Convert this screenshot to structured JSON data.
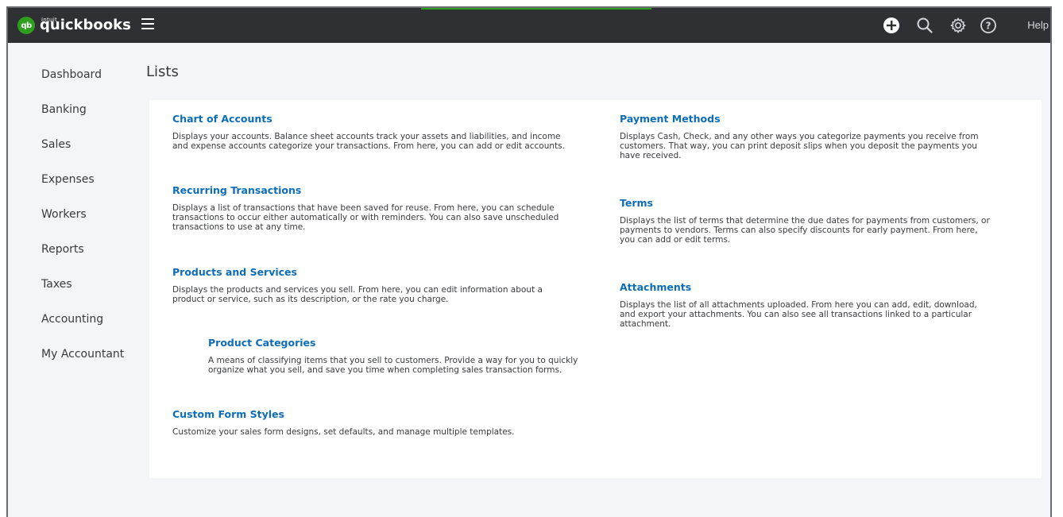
{
  "app": {
    "brand_sup": "intuit",
    "brand": "quickbooks",
    "badge": "qb",
    "help_label": "Help"
  },
  "colors": {
    "topbar": "#2f3033",
    "brand_green": "#2ca01c",
    "link_blue": "#0d6db5",
    "page_bg": "#f4f5f8"
  },
  "icons": [
    "menu-icon",
    "add-icon",
    "search-icon",
    "gear-icon",
    "help-icon"
  ],
  "sidebar": {
    "items": [
      {
        "label": "Dashboard"
      },
      {
        "label": "Banking"
      },
      {
        "label": "Sales"
      },
      {
        "label": "Expenses"
      },
      {
        "label": "Workers"
      },
      {
        "label": "Reports"
      },
      {
        "label": "Taxes"
      },
      {
        "label": "Accounting"
      },
      {
        "label": "My Accountant"
      }
    ]
  },
  "page": {
    "title": "Lists"
  },
  "lists": {
    "chart_of_accounts": {
      "title": "Chart of Accounts",
      "desc_lines": [
        "Displays your accounts. Balance sheet accounts track your assets and liabilities, and income",
        "and expense accounts categorize your transactions. From here, you can add or edit accounts."
      ]
    },
    "recurring_transactions": {
      "title": "Recurring Transactions",
      "desc_lines": [
        "Displays a list of transactions that have been saved for reuse. From here, you can schedule",
        "transactions to occur either automatically or with reminders. You can also save unscheduled",
        "transactions to use at any time."
      ]
    },
    "products_services": {
      "title": "Products and Services",
      "desc_lines": [
        "Displays the products and services you sell. From here, you can edit information about a",
        "product or service, such as its description, or the rate you charge."
      ]
    },
    "product_categories": {
      "title": "Product Categories",
      "desc_lines": [
        "A means of classifying items that you sell to customers. Provide a way for you to quickly",
        "organize what you sell, and save you time when completing sales transaction forms."
      ]
    },
    "custom_form_styles": {
      "title": "Custom Form Styles",
      "desc_lines": [
        "Customize your sales form designs, set defaults, and manage multiple templates."
      ]
    },
    "payment_methods": {
      "title": "Payment Methods",
      "desc_lines": [
        "Displays Cash, Check, and any other ways you categorize payments you receive from",
        "customers. That way, you can print deposit slips when you deposit the payments you",
        "have received."
      ]
    },
    "terms": {
      "title": "Terms",
      "desc_lines": [
        "Displays the list of terms that determine the due dates for payments from customers, or",
        "payments to vendors. Terms can also specify discounts for early payment. From here,",
        "you can add or edit terms."
      ]
    },
    "attachments": {
      "title": "Attachments",
      "desc_lines": [
        "Displays the list of all attachments uploaded. From here you can add, edit, download,",
        "and export your attachments. You can also see all transactions linked to a particular",
        "attachment."
      ]
    }
  }
}
